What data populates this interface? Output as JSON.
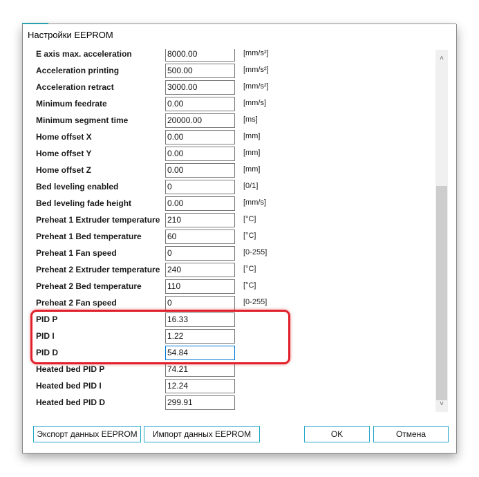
{
  "window": {
    "title": "Настройки EEPROM"
  },
  "rows": [
    {
      "label": "E axis max. acceleration",
      "value": "8000.00",
      "unit": "[mm/s²]"
    },
    {
      "label": "Acceleration printing",
      "value": "500.00",
      "unit": "[mm/s²]"
    },
    {
      "label": "Acceleration retract",
      "value": "3000.00",
      "unit": "[mm/s²]"
    },
    {
      "label": "Minimum feedrate",
      "value": "0.00",
      "unit": "[mm/s]"
    },
    {
      "label": "Minimum segment time",
      "value": "20000.00",
      "unit": "[ms]"
    },
    {
      "label": "Home offset X",
      "value": "0.00",
      "unit": "[mm]"
    },
    {
      "label": "Home offset Y",
      "value": "0.00",
      "unit": "[mm]"
    },
    {
      "label": "Home offset Z",
      "value": "0.00",
      "unit": "[mm]"
    },
    {
      "label": "Bed leveling enabled",
      "value": "0",
      "unit": "[0/1]"
    },
    {
      "label": "Bed leveling fade height",
      "value": "0.00",
      "unit": "[mm/s]"
    },
    {
      "label": "Preheat 1 Extruder temperature",
      "value": "210",
      "unit": "[°C]"
    },
    {
      "label": "Preheat 1 Bed temperature",
      "value": "60",
      "unit": "[°C]"
    },
    {
      "label": "Preheat 1 Fan speed",
      "value": "0",
      "unit": "[0-255]"
    },
    {
      "label": "Preheat 2 Extruder temperature",
      "value": "240",
      "unit": "[°C]"
    },
    {
      "label": "Preheat 2 Bed temperature",
      "value": "110",
      "unit": "[°C]"
    },
    {
      "label": "Preheat 2 Fan speed",
      "value": "0",
      "unit": "[0-255]"
    },
    {
      "label": "PID P",
      "value": "16.33",
      "unit": ""
    },
    {
      "label": "PID I",
      "value": "1.22",
      "unit": ""
    },
    {
      "label": "PID D",
      "value": "54.84",
      "unit": "",
      "focused": true
    },
    {
      "label": "Heated bed PID P",
      "value": "74.21",
      "unit": ""
    },
    {
      "label": "Heated bed PID I",
      "value": "12.24",
      "unit": ""
    },
    {
      "label": "Heated bed PID D",
      "value": "299.91",
      "unit": ""
    }
  ],
  "buttons": {
    "export": "Экспорт данных EEPROM",
    "import": "Импорт данных EEPROM",
    "ok": "OK",
    "cancel": "Отмена"
  },
  "colors": {
    "highlight": "#e0202a",
    "button_border": "#22a6c8",
    "focus": "#0078d7"
  }
}
